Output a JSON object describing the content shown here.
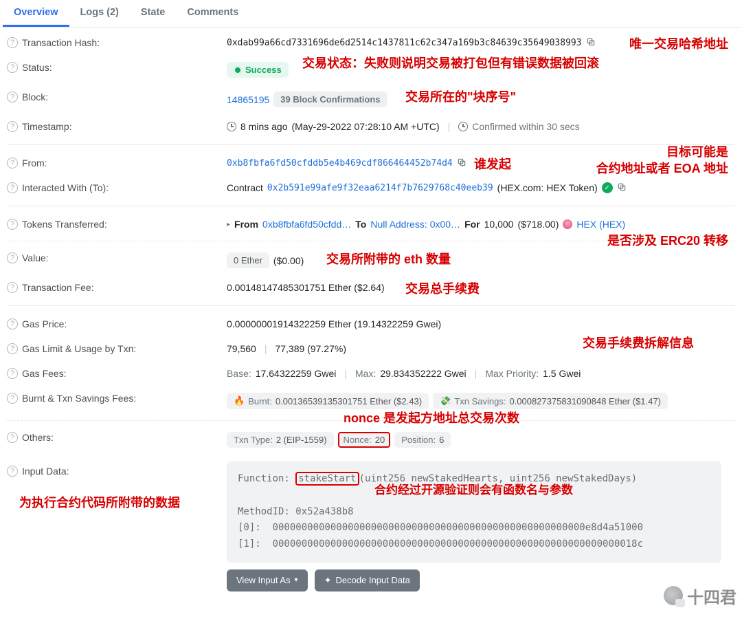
{
  "tabs": {
    "overview": "Overview",
    "logs": "Logs (2)",
    "state": "State",
    "comments": "Comments"
  },
  "labels": {
    "hash": "Transaction Hash:",
    "status": "Status:",
    "block": "Block:",
    "timestamp": "Timestamp:",
    "from": "From:",
    "to": "Interacted With (To):",
    "tokens": "Tokens Transferred:",
    "value": "Value:",
    "fee": "Transaction Fee:",
    "gasprice": "Gas Price:",
    "gaslimit": "Gas Limit & Usage by Txn:",
    "gasfees": "Gas Fees:",
    "burnt": "Burnt & Txn Savings Fees:",
    "others": "Others:",
    "inputdata": "Input Data:"
  },
  "hash": "0xdab99a66cd7331696de6d2514c1437811c62c347a169b3c84639c35649038993",
  "status_text": "Success",
  "block": {
    "number": "14865195",
    "confirm": "39 Block Confirmations"
  },
  "timestamp": {
    "ago": "8 mins ago",
    "full": "(May-29-2022 07:28:10 AM +UTC)",
    "conf": "Confirmed within 30 secs"
  },
  "from": "0xb8fbfa6fd50cfddb5e4b469cdf866464452b74d4",
  "to": {
    "prefix": "Contract",
    "addr": "0x2b591e99afe9f32eaa6214f7b7629768c40eeb39",
    "suffix": "(HEX.com: HEX Token)"
  },
  "tokens": {
    "from_lbl": "From",
    "from_addr": "0xb8fbfa6fd50cfdd…",
    "to_lbl": "To",
    "to_addr": "Null Address: 0x00…",
    "for_lbl": "For",
    "amount": "10,000",
    "usd": "($718.00)",
    "symbol": "HEX (HEX)"
  },
  "value": {
    "chip": "0 Ether",
    "usd": "($0.00)"
  },
  "fee": "0.00148147485301751 Ether ($2.64)",
  "gasprice": "0.00000001914322259 Ether (19.14322259 Gwei)",
  "gaslimit": {
    "limit": "79,560",
    "used": "77,389 (97.27%)"
  },
  "gasfees": {
    "base_lbl": "Base:",
    "base": "17.64322259 Gwei",
    "max_lbl": "Max:",
    "max": "29.834352222 Gwei",
    "maxp_lbl": "Max Priority:",
    "maxp": "1.5 Gwei"
  },
  "burnt": {
    "burnt_lbl": "Burnt:",
    "burnt": "0.00136539135301751 Ether ($2.43)",
    "save_lbl": "Txn Savings:",
    "save": "0.000827375831090848 Ether ($1.47)"
  },
  "others": {
    "type_lbl": "Txn Type:",
    "type": "2 (EIP-1559)",
    "nonce_lbl": "Nonce:",
    "nonce": "20",
    "pos_lbl": "Position:",
    "pos": "6"
  },
  "input": {
    "fn_lbl": "Function:",
    "fn_name": "stakeStart",
    "fn_sig": "(uint256 newStakedHearts, uint256 newStakedDays)",
    "mid_lbl": "MethodID:",
    "mid": "0x52a438b8",
    "p0_lbl": "[0]:",
    "p0": "000000000000000000000000000000000000000000000000000000e8d4a51000",
    "p1_lbl": "[1]:",
    "p1": "000000000000000000000000000000000000000000000000000000000000018c"
  },
  "buttons": {
    "view_as": "View Input As",
    "decode": "Decode Input Data"
  },
  "annotations": {
    "hash_a": "唯一交易哈希地址",
    "status_a": "交易状态：失败则说明交易被打包但有错误数据被回滚",
    "block_a": "交易所在的\"块序号\"",
    "from_a": "谁发起",
    "to_a1": "目标可能是",
    "to_a2": "合约地址或者 EOA 地址",
    "erc20_a": "是否涉及 ERC20 转移",
    "value_a": "交易所附带的 eth 数量",
    "fee_a": "交易总手续费",
    "gas_a": "交易手续费拆解信息",
    "nonce_a": "nonce 是发起方地址总交易次数",
    "input_a": "为执行合约代码所附带的数据",
    "func_a": "合约经过开源验证则会有函数名与参数"
  },
  "watermark": "十四君"
}
